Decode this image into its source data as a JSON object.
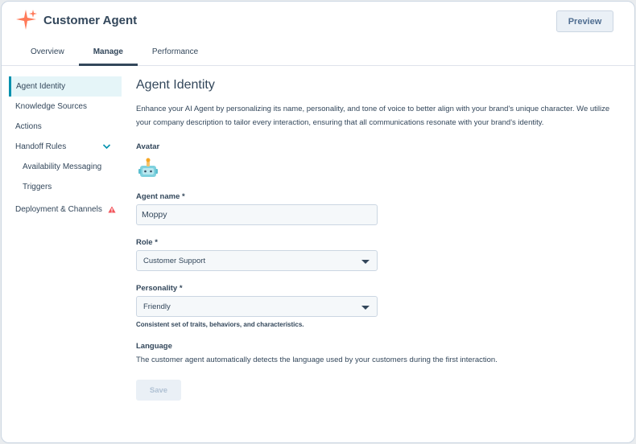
{
  "app": {
    "title": "Customer Agent",
    "preview_label": "Preview"
  },
  "tabs": [
    {
      "label": "Overview",
      "active": false
    },
    {
      "label": "Manage",
      "active": true
    },
    {
      "label": "Performance",
      "active": false
    }
  ],
  "sidebar": {
    "items": [
      {
        "label": "Agent Identity",
        "active": true
      },
      {
        "label": "Knowledge Sources"
      },
      {
        "label": "Actions"
      },
      {
        "label": "Handoff Rules",
        "expanded": true
      },
      {
        "label": "Availability Messaging"
      },
      {
        "label": "Triggers"
      },
      {
        "label": "Deployment & Channels",
        "warning": true
      }
    ]
  },
  "main": {
    "title": "Agent Identity",
    "description": "Enhance your AI Agent by personalizing its name, personality, and tone of voice to better align with your brand's unique character. We utilize your company description to tailor every interaction, ensuring that all communications resonate with your brand's identity.",
    "avatar_label": "Avatar",
    "name_label": "Agent name *",
    "name_value": "Moppy",
    "role_label": "Role *",
    "role_value": "Customer Support",
    "personality_label": "Personality *",
    "personality_value": "Friendly",
    "personality_hint": "Consistent set of traits, behaviors, and characteristics.",
    "language_label": "Language",
    "language_text": "The customer agent automatically detects the language used by your customers during the first interaction.",
    "save_label": "Save"
  },
  "colors": {
    "accent": "#0091ae",
    "brand_orange": "#ff7a59",
    "text": "#33475b",
    "warning": "#f2545b"
  },
  "icons": {
    "logo": "sparkle-icon",
    "chevron": "chevron-down-icon",
    "warning": "warning-icon",
    "avatar": "robot-avatar-icon",
    "dropdown": "caret-down-icon"
  }
}
